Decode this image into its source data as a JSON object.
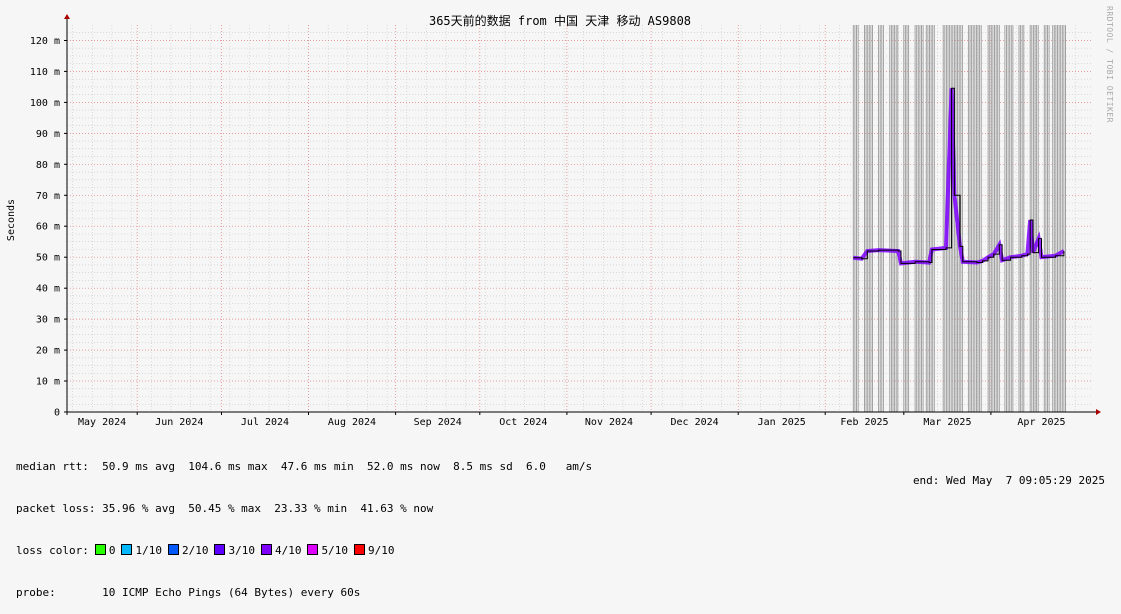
{
  "chart_data": {
    "type": "line",
    "title": "365天前的数据 from 中国 天津 移动 AS9808",
    "ylabel": "Seconds",
    "ylim": [
      0,
      0.125
    ],
    "y_ticks": [
      {
        "v": 0,
        "label": "0"
      },
      {
        "v": 0.01,
        "label": "10 m"
      },
      {
        "v": 0.02,
        "label": "20 m"
      },
      {
        "v": 0.03,
        "label": "30 m"
      },
      {
        "v": 0.04,
        "label": "40 m"
      },
      {
        "v": 0.05,
        "label": "50 m"
      },
      {
        "v": 0.06,
        "label": "60 m"
      },
      {
        "v": 0.07,
        "label": "70 m"
      },
      {
        "v": 0.08,
        "label": "80 m"
      },
      {
        "v": 0.09,
        "label": "90 m"
      },
      {
        "v": 0.1,
        "label": "100 m"
      },
      {
        "v": 0.11,
        "label": "110 m"
      },
      {
        "v": 0.12,
        "label": "120 m"
      }
    ],
    "xlim": [
      "2024-05-07",
      "2025-05-07"
    ],
    "x_ticks": [
      {
        "date": "2024-05-01",
        "label": "May 2024"
      },
      {
        "date": "2024-06-01",
        "label": "Jun 2024"
      },
      {
        "date": "2024-07-01",
        "label": "Jul 2024"
      },
      {
        "date": "2024-08-01",
        "label": "Aug 2024"
      },
      {
        "date": "2024-09-01",
        "label": "Sep 2024"
      },
      {
        "date": "2024-10-01",
        "label": "Oct 2024"
      },
      {
        "date": "2024-11-01",
        "label": "Nov 2024"
      },
      {
        "date": "2024-12-01",
        "label": "Dec 2024"
      },
      {
        "date": "2025-01-01",
        "label": "Jan 2025"
      },
      {
        "date": "2025-02-01",
        "label": "Feb 2025"
      },
      {
        "date": "2025-03-01",
        "label": "Mar 2025"
      },
      {
        "date": "2025-04-01",
        "label": "Apr 2025"
      }
    ],
    "grid": true,
    "median_rtt": [
      {
        "date": "2025-02-11",
        "ms": 49.8
      },
      {
        "date": "2025-02-14",
        "ms": 49.5
      },
      {
        "date": "2025-02-16",
        "ms": 52.0
      },
      {
        "date": "2025-02-20",
        "ms": 52.3
      },
      {
        "date": "2025-02-27",
        "ms": 52.0
      },
      {
        "date": "2025-02-28",
        "ms": 48.0
      },
      {
        "date": "2025-03-05",
        "ms": 48.5
      },
      {
        "date": "2025-03-10",
        "ms": 48.3
      },
      {
        "date": "2025-03-11",
        "ms": 52.5
      },
      {
        "date": "2025-03-16",
        "ms": 53.0
      },
      {
        "date": "2025-03-18",
        "ms": 104.6
      },
      {
        "date": "2025-03-19",
        "ms": 70.0
      },
      {
        "date": "2025-03-21",
        "ms": 53.5
      },
      {
        "date": "2025-03-22",
        "ms": 48.5
      },
      {
        "date": "2025-03-27",
        "ms": 48.3
      },
      {
        "date": "2025-03-29",
        "ms": 48.8
      },
      {
        "date": "2025-03-31",
        "ms": 50.0
      },
      {
        "date": "2025-04-02",
        "ms": 51.0
      },
      {
        "date": "2025-04-04",
        "ms": 54.0
      },
      {
        "date": "2025-04-05",
        "ms": 49.0
      },
      {
        "date": "2025-04-08",
        "ms": 50.0
      },
      {
        "date": "2025-04-12",
        "ms": 50.5
      },
      {
        "date": "2025-04-14",
        "ms": 51.0
      },
      {
        "date": "2025-04-15",
        "ms": 62.0
      },
      {
        "date": "2025-04-16",
        "ms": 51.5
      },
      {
        "date": "2025-04-18",
        "ms": 56.0
      },
      {
        "date": "2025-04-19",
        "ms": 50.0
      },
      {
        "date": "2025-04-24",
        "ms": 50.5
      },
      {
        "date": "2025-04-27",
        "ms": 52.0
      }
    ],
    "outage_ranges": [
      [
        "2025-02-11",
        "2025-02-13"
      ],
      [
        "2025-02-15",
        "2025-02-18"
      ],
      [
        "2025-02-20",
        "2025-02-22"
      ],
      [
        "2025-02-24",
        "2025-02-27"
      ],
      [
        "2025-03-01",
        "2025-03-03"
      ],
      [
        "2025-03-05",
        "2025-03-08"
      ],
      [
        "2025-03-09",
        "2025-03-12"
      ],
      [
        "2025-03-15",
        "2025-03-22"
      ],
      [
        "2025-03-24",
        "2025-03-29"
      ],
      [
        "2025-03-31",
        "2025-04-04"
      ],
      [
        "2025-04-06",
        "2025-04-09"
      ],
      [
        "2025-04-11",
        "2025-04-13"
      ],
      [
        "2025-04-15",
        "2025-04-18"
      ],
      [
        "2025-04-20",
        "2025-04-22"
      ],
      [
        "2025-04-23",
        "2025-04-28"
      ]
    ]
  },
  "stats": {
    "rtt_label": "median rtt:",
    "rtt_values": "50.9 ms avg  104.6 ms max  47.6 ms min  52.0 ms now  8.5 ms sd  6.0   am/s",
    "loss_label": "packet loss:",
    "loss_values": "35.96 % avg  50.45 % max  23.33 % min  41.63 % now",
    "color_label": "loss color:",
    "probe_label": "probe:",
    "probe_value": "10 ICMP Echo Pings (64 Bytes) every 60s",
    "end_text": "end: Wed May  7 09:05:29 2025"
  },
  "loss_colors": [
    {
      "label": "0",
      "color": "#26ff00"
    },
    {
      "label": "1/10",
      "color": "#00b8ff"
    },
    {
      "label": "2/10",
      "color": "#0059ff"
    },
    {
      "label": "3/10",
      "color": "#5e00ff"
    },
    {
      "label": "4/10",
      "color": "#7e00ff"
    },
    {
      "label": "5/10",
      "color": "#dd00ff"
    },
    {
      "label": "9/10",
      "color": "#ff0000"
    }
  ],
  "vendor": "RRDTOOL / TOBI OETIKER",
  "colors": {
    "line": "#000000",
    "loss_band": "#7e00ff",
    "outage": "#9a9a9a",
    "grid_major": "#e08080",
    "grid_minor": "#c8c8c8"
  }
}
